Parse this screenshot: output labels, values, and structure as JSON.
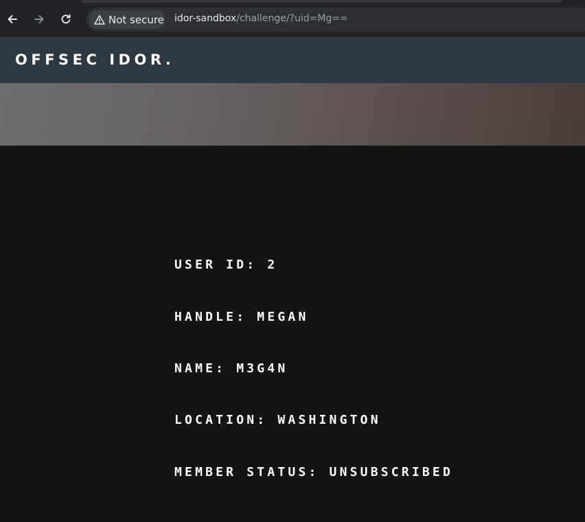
{
  "browser": {
    "security_label": "Not secure",
    "url_host": "idor-sandbox",
    "url_path": "/challenge/?uid=Mg==",
    "icons": {
      "back": "arrow-left-icon",
      "forward": "arrow-right-icon",
      "reload": "reload-icon",
      "security": "warning-triangle-icon"
    }
  },
  "header": {
    "logo": "OFFSEC IDOR."
  },
  "profile": {
    "user_id": "USER ID: 2",
    "handle": "HANDLE: MEGAN",
    "name": "NAME: M3G4N",
    "location": "LOCATION: WASHINGTON",
    "member_status": "MEMBER STATUS: UNSUBSCRIBED"
  },
  "colors": {
    "page_background": "#141414",
    "header_background": "#2e3840",
    "text": "#ffffff"
  }
}
